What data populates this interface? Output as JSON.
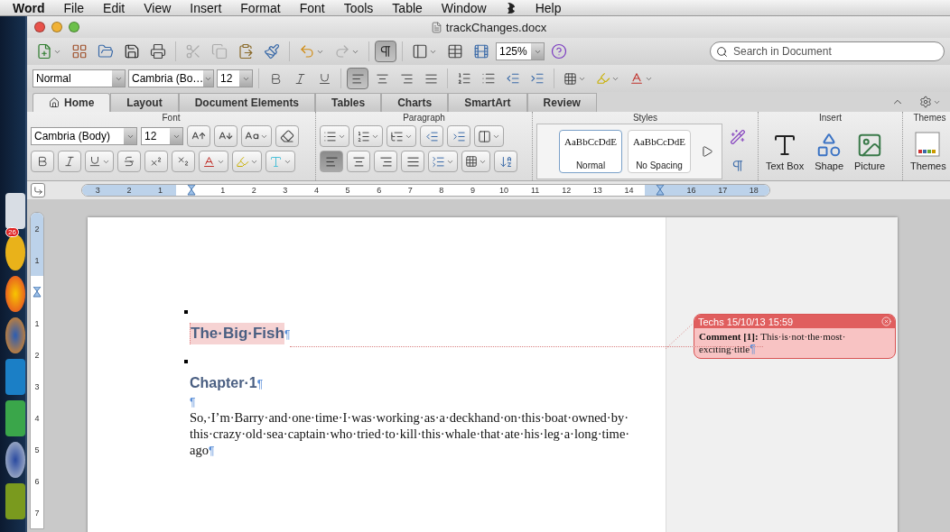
{
  "menu_bar": {
    "app": "Word",
    "items": [
      {
        "kind": "text",
        "label": "File"
      },
      {
        "kind": "text",
        "label": "Edit"
      },
      {
        "kind": "text",
        "label": "View"
      },
      {
        "kind": "text",
        "label": "Insert"
      },
      {
        "kind": "text",
        "label": "Format"
      },
      {
        "kind": "text",
        "label": "Font"
      },
      {
        "kind": "text",
        "label": "Tools"
      },
      {
        "kind": "text",
        "label": "Table"
      },
      {
        "kind": "text",
        "label": "Window"
      },
      {
        "kind": "icon"
      },
      {
        "kind": "text",
        "label": "Help"
      }
    ]
  },
  "dock": {
    "badge": "26"
  },
  "window": {
    "title": "trackChanges.docx"
  },
  "toolbar": {
    "show_marks": true,
    "zoom": "125%",
    "search": {
      "placeholder": "Search in Document"
    }
  },
  "format_bar": {
    "style": "Normal",
    "font": "Cambria (Bo…",
    "size": "12",
    "align": [
      {
        "selected": true
      },
      {
        "selected": false
      },
      {
        "selected": false
      },
      {
        "selected": false
      }
    ]
  },
  "ribbon": {
    "tabs": [
      {
        "label": "Home",
        "selected": true
      },
      {
        "label": "Layout",
        "selected": false
      },
      {
        "label": "Document Elements",
        "selected": false
      },
      {
        "label": "Tables",
        "selected": false
      },
      {
        "label": "Charts",
        "selected": false
      },
      {
        "label": "SmartArt",
        "selected": false
      },
      {
        "label": "Review",
        "selected": false
      }
    ],
    "groups": {
      "font": "Font",
      "paragraph": "Paragraph",
      "styles": "Styles",
      "insert": "Insert",
      "themes": "Themes"
    },
    "font": "Cambria (Body)",
    "size": "12",
    "align": [
      {
        "selected": true
      },
      {
        "selected": false
      },
      {
        "selected": false
      },
      {
        "selected": false
      }
    ],
    "styles": [
      {
        "preview": "AaBbCcDdE",
        "label": "Normal",
        "selected": true
      },
      {
        "preview": "AaBbCcDdE",
        "label": "No Spacing",
        "selected": false
      }
    ],
    "insert": [
      {
        "kind": "textbox",
        "label": "Text Box"
      },
      {
        "kind": "shape",
        "label": "Shape"
      },
      {
        "kind": "picture",
        "label": "Picture"
      }
    ],
    "themes": "Themes"
  },
  "ruler": [
    {
      "kind": "number",
      "label": "3",
      "margin": true
    },
    {
      "kind": "number",
      "label": "2",
      "margin": true
    },
    {
      "kind": "number",
      "label": "1",
      "margin": true
    },
    {
      "kind": "marker",
      "margin": false
    },
    {
      "kind": "number",
      "label": "1",
      "margin": false
    },
    {
      "kind": "number",
      "label": "2",
      "margin": false
    },
    {
      "kind": "number",
      "label": "3",
      "margin": false
    },
    {
      "kind": "number",
      "label": "4",
      "margin": false
    },
    {
      "kind": "number",
      "label": "5",
      "margin": false
    },
    {
      "kind": "number",
      "label": "6",
      "margin": false
    },
    {
      "kind": "number",
      "label": "7",
      "margin": false
    },
    {
      "kind": "number",
      "label": "8",
      "margin": false
    },
    {
      "kind": "number",
      "label": "9",
      "margin": false
    },
    {
      "kind": "number",
      "label": "10",
      "margin": false
    },
    {
      "kind": "number",
      "label": "11",
      "margin": false
    },
    {
      "kind": "number",
      "label": "12",
      "margin": false
    },
    {
      "kind": "number",
      "label": "13",
      "margin": false
    },
    {
      "kind": "number",
      "label": "14",
      "margin": false
    },
    {
      "kind": "marker",
      "margin": true
    },
    {
      "kind": "number",
      "label": "16",
      "margin": true
    },
    {
      "kind": "number",
      "label": "17",
      "margin": true
    },
    {
      "kind": "number",
      "label": "18",
      "margin": true
    }
  ],
  "vertical_ruler": [
    {
      "kind": "number",
      "label": "2",
      "margin": true
    },
    {
      "kind": "number",
      "label": "1",
      "margin": true
    },
    {
      "kind": "marker",
      "margin": false
    },
    {
      "kind": "number",
      "label": "1",
      "margin": false
    },
    {
      "kind": "number",
      "label": "2",
      "margin": false
    },
    {
      "kind": "number",
      "label": "3",
      "margin": false
    },
    {
      "kind": "number",
      "label": "4",
      "margin": false
    },
    {
      "kind": "number",
      "label": "5",
      "margin": false
    },
    {
      "kind": "number",
      "label": "6",
      "margin": false
    },
    {
      "kind": "number",
      "label": "7",
      "margin": false
    }
  ],
  "document": {
    "paragraphs": [
      {
        "kind": "title",
        "text": "The·Big·Fish",
        "mark": "¶",
        "commented": true
      },
      {
        "kind": "heading",
        "text": "Chapter·1",
        "mark": "¶",
        "commented": false
      },
      {
        "kind": "empty",
        "mark": "¶",
        "commented": false
      },
      {
        "kind": "body",
        "lines": [
          "So,·I’m·Barry·and·one·time·I·was·working·as·a·deckhand·on·this·boat·owned·by·",
          "this·crazy·old·sea·captain·who·tried·to·kill·this·whale·that·ate·his·leg·a·long·time·",
          "ago"
        ],
        "mark": "¶",
        "commented": false
      }
    ]
  },
  "comment": {
    "header": "Techs 15/10/13 15:59",
    "lines": [
      "**Comment [1]:** This·is·not·the·most·",
      "exciting·title"
    ],
    "mark": "¶"
  }
}
